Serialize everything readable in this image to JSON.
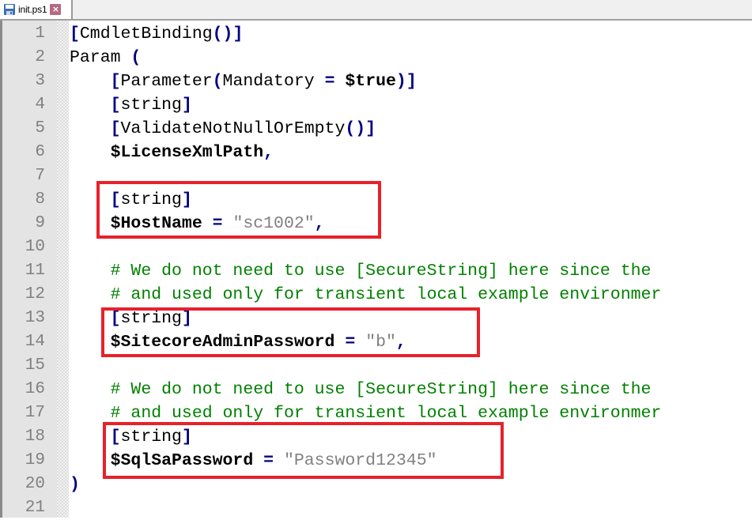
{
  "tab": {
    "icon": "save-disk-icon",
    "label": "init.ps1",
    "close_icon": "close-icon"
  },
  "colors": {
    "highlight_box": "#e8212b",
    "comment": "#008000",
    "string": "#808080",
    "operator": "#000080",
    "line_number": "#808080"
  },
  "editor": {
    "line_numbers": [
      "1",
      "2",
      "3",
      "4",
      "5",
      "6",
      "7",
      "8",
      "9",
      "10",
      "11",
      "12",
      "13",
      "14",
      "15",
      "16",
      "17",
      "18",
      "19",
      "20",
      "21"
    ],
    "lines": [
      {
        "tokens": [
          {
            "t": "[",
            "c": "op"
          },
          {
            "t": "CmdletBinding",
            "c": "kw"
          },
          {
            "t": "()",
            "c": "op"
          },
          {
            "t": "]",
            "c": "op"
          }
        ]
      },
      {
        "tokens": [
          {
            "t": "Param ",
            "c": "kw"
          },
          {
            "t": "(",
            "c": "op"
          }
        ]
      },
      {
        "tokens": [
          {
            "t": "    ",
            "c": "kw"
          },
          {
            "t": "[",
            "c": "op"
          },
          {
            "t": "Parameter",
            "c": "kw"
          },
          {
            "t": "(",
            "c": "op"
          },
          {
            "t": "Mandatory ",
            "c": "kw"
          },
          {
            "t": "=",
            "c": "op"
          },
          {
            "t": " ",
            "c": "kw"
          },
          {
            "t": "$true",
            "c": "var"
          },
          {
            "t": ")",
            "c": "op"
          },
          {
            "t": "]",
            "c": "op"
          }
        ]
      },
      {
        "tokens": [
          {
            "t": "    ",
            "c": "kw"
          },
          {
            "t": "[",
            "c": "op"
          },
          {
            "t": "string",
            "c": "kw"
          },
          {
            "t": "]",
            "c": "op"
          }
        ]
      },
      {
        "tokens": [
          {
            "t": "    ",
            "c": "kw"
          },
          {
            "t": "[",
            "c": "op"
          },
          {
            "t": "ValidateNotNullOrEmpty",
            "c": "kw"
          },
          {
            "t": "()",
            "c": "op"
          },
          {
            "t": "]",
            "c": "op"
          }
        ]
      },
      {
        "tokens": [
          {
            "t": "    ",
            "c": "kw"
          },
          {
            "t": "$LicenseXmlPath",
            "c": "var"
          },
          {
            "t": ",",
            "c": "op"
          }
        ]
      },
      {
        "tokens": []
      },
      {
        "tokens": [
          {
            "t": "    ",
            "c": "kw"
          },
          {
            "t": "[",
            "c": "op"
          },
          {
            "t": "string",
            "c": "kw"
          },
          {
            "t": "]",
            "c": "op"
          }
        ]
      },
      {
        "tokens": [
          {
            "t": "    ",
            "c": "kw"
          },
          {
            "t": "$HostName",
            "c": "var"
          },
          {
            "t": " ",
            "c": "kw"
          },
          {
            "t": "=",
            "c": "op"
          },
          {
            "t": " ",
            "c": "kw"
          },
          {
            "t": "\"sc1002\"",
            "c": "str"
          },
          {
            "t": ",",
            "c": "op"
          }
        ]
      },
      {
        "tokens": []
      },
      {
        "tokens": [
          {
            "t": "    # We do not need to use [SecureString] here since the",
            "c": "cm"
          }
        ]
      },
      {
        "tokens": [
          {
            "t": "    # and used only for transient local example environmer",
            "c": "cm"
          }
        ]
      },
      {
        "tokens": [
          {
            "t": "    ",
            "c": "kw"
          },
          {
            "t": "[",
            "c": "op"
          },
          {
            "t": "string",
            "c": "kw"
          },
          {
            "t": "]",
            "c": "op"
          }
        ]
      },
      {
        "tokens": [
          {
            "t": "    ",
            "c": "kw"
          },
          {
            "t": "$SitecoreAdminPassword",
            "c": "var"
          },
          {
            "t": " ",
            "c": "kw"
          },
          {
            "t": "=",
            "c": "op"
          },
          {
            "t": " ",
            "c": "kw"
          },
          {
            "t": "\"b\"",
            "c": "str"
          },
          {
            "t": ",",
            "c": "op"
          }
        ]
      },
      {
        "tokens": []
      },
      {
        "tokens": [
          {
            "t": "    # We do not need to use [SecureString] here since the",
            "c": "cm"
          }
        ]
      },
      {
        "tokens": [
          {
            "t": "    # and used only for transient local example environmer",
            "c": "cm"
          }
        ]
      },
      {
        "tokens": [
          {
            "t": "    ",
            "c": "kw"
          },
          {
            "t": "[",
            "c": "op"
          },
          {
            "t": "string",
            "c": "kw"
          },
          {
            "t": "]",
            "c": "op"
          }
        ]
      },
      {
        "tokens": [
          {
            "t": "    ",
            "c": "kw"
          },
          {
            "t": "$SqlSaPassword",
            "c": "var"
          },
          {
            "t": " ",
            "c": "kw"
          },
          {
            "t": "=",
            "c": "op"
          },
          {
            "t": " ",
            "c": "kw"
          },
          {
            "t": "\"Password12345\"",
            "c": "str"
          }
        ]
      },
      {
        "tokens": [
          {
            "t": ")",
            "c": "op"
          }
        ]
      },
      {
        "tokens": []
      }
    ],
    "highlight_boxes": [
      {
        "name": "hostname-highlight",
        "lines": [
          8,
          9
        ]
      },
      {
        "name": "sitecore-admin-password-highlight",
        "lines": [
          13,
          14
        ]
      },
      {
        "name": "sql-sa-password-highlight",
        "lines": [
          18,
          19
        ]
      }
    ]
  }
}
